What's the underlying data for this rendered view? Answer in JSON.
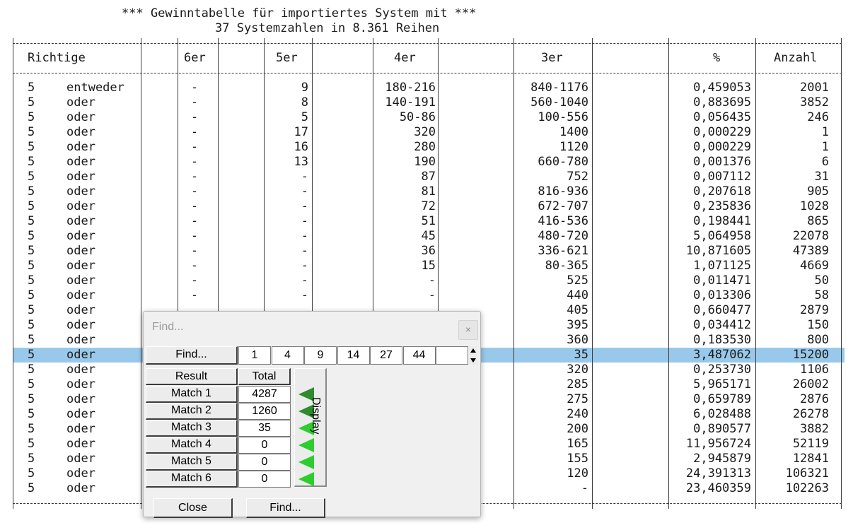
{
  "report": {
    "title_line1": "*** Gewinntabelle für importiertes System mit ***",
    "title_line2": "37 Systemzahlen in 8.361 Reihen",
    "headers": [
      "Richtige",
      "6er",
      "5er",
      "4er",
      "3er",
      "%",
      "Anzahl"
    ],
    "rows": [
      {
        "richtige": "5",
        "mode": "entweder",
        "c6": "-",
        "c5": "9",
        "c4": "180-216",
        "c3": "840-1176",
        "pct": "0,459053",
        "anzahl": "2001"
      },
      {
        "richtige": "5",
        "mode": "oder",
        "c6": "-",
        "c5": "8",
        "c4": "140-191",
        "c3": "560-1040",
        "pct": "0,883695",
        "anzahl": "3852"
      },
      {
        "richtige": "5",
        "mode": "oder",
        "c6": "-",
        "c5": "5",
        "c4": "50-86",
        "c3": "100-556",
        "pct": "0,056435",
        "anzahl": "246"
      },
      {
        "richtige": "5",
        "mode": "oder",
        "c6": "-",
        "c5": "17",
        "c4": "320",
        "c3": "1400",
        "pct": "0,000229",
        "anzahl": "1"
      },
      {
        "richtige": "5",
        "mode": "oder",
        "c6": "-",
        "c5": "16",
        "c4": "280",
        "c3": "1120",
        "pct": "0,000229",
        "anzahl": "1"
      },
      {
        "richtige": "5",
        "mode": "oder",
        "c6": "-",
        "c5": "13",
        "c4": "190",
        "c3": "660-780",
        "pct": "0,001376",
        "anzahl": "6"
      },
      {
        "richtige": "5",
        "mode": "oder",
        "c6": "-",
        "c5": "-",
        "c4": "87",
        "c3": "752",
        "pct": "0,007112",
        "anzahl": "31"
      },
      {
        "richtige": "5",
        "mode": "oder",
        "c6": "-",
        "c5": "-",
        "c4": "81",
        "c3": "816-936",
        "pct": "0,207618",
        "anzahl": "905"
      },
      {
        "richtige": "5",
        "mode": "oder",
        "c6": "-",
        "c5": "-",
        "c4": "72",
        "c3": "672-707",
        "pct": "0,235836",
        "anzahl": "1028"
      },
      {
        "richtige": "5",
        "mode": "oder",
        "c6": "-",
        "c5": "-",
        "c4": "51",
        "c3": "416-536",
        "pct": "0,198441",
        "anzahl": "865"
      },
      {
        "richtige": "5",
        "mode": "oder",
        "c6": "-",
        "c5": "-",
        "c4": "45",
        "c3": "480-720",
        "pct": "5,064958",
        "anzahl": "22078"
      },
      {
        "richtige": "5",
        "mode": "oder",
        "c6": "-",
        "c5": "-",
        "c4": "36",
        "c3": "336-621",
        "pct": "10,871605",
        "anzahl": "47389"
      },
      {
        "richtige": "5",
        "mode": "oder",
        "c6": "-",
        "c5": "-",
        "c4": "15",
        "c3": "80-365",
        "pct": "1,071125",
        "anzahl": "4669"
      },
      {
        "richtige": "5",
        "mode": "oder",
        "c6": "-",
        "c5": "-",
        "c4": "-",
        "c3": "525",
        "pct": "0,011471",
        "anzahl": "50"
      },
      {
        "richtige": "5",
        "mode": "oder",
        "c6": "-",
        "c5": "-",
        "c4": "-",
        "c3": "440",
        "pct": "0,013306",
        "anzahl": "58"
      },
      {
        "richtige": "5",
        "mode": "oder",
        "c6": "",
        "c5": "",
        "c4": "",
        "c3": "405",
        "pct": "0,660477",
        "anzahl": "2879"
      },
      {
        "richtige": "5",
        "mode": "oder",
        "c6": "",
        "c5": "",
        "c4": "",
        "c3": "395",
        "pct": "0,034412",
        "anzahl": "150"
      },
      {
        "richtige": "5",
        "mode": "oder",
        "c6": "",
        "c5": "",
        "c4": "",
        "c3": "360",
        "pct": "0,183530",
        "anzahl": "800"
      },
      {
        "richtige": "5",
        "mode": "oder",
        "c6": "",
        "c5": "",
        "c4": "",
        "c3": "35",
        "pct": "3,487062",
        "anzahl": "15200",
        "selected": true
      },
      {
        "richtige": "5",
        "mode": "oder",
        "c6": "",
        "c5": "",
        "c4": "",
        "c3": "320",
        "pct": "0,253730",
        "anzahl": "1106"
      },
      {
        "richtige": "5",
        "mode": "oder",
        "c6": "",
        "c5": "",
        "c4": "",
        "c3": "285",
        "pct": "5,965171",
        "anzahl": "26002"
      },
      {
        "richtige": "5",
        "mode": "oder",
        "c6": "",
        "c5": "",
        "c4": "",
        "c3": "275",
        "pct": "0,659789",
        "anzahl": "2876"
      },
      {
        "richtige": "5",
        "mode": "oder",
        "c6": "",
        "c5": "",
        "c4": "",
        "c3": "240",
        "pct": "6,028488",
        "anzahl": "26278"
      },
      {
        "richtige": "5",
        "mode": "oder",
        "c6": "",
        "c5": "",
        "c4": "",
        "c3": "200",
        "pct": "0,890577",
        "anzahl": "3882"
      },
      {
        "richtige": "5",
        "mode": "oder",
        "c6": "",
        "c5": "",
        "c4": "",
        "c3": "165",
        "pct": "11,956724",
        "anzahl": "52119"
      },
      {
        "richtige": "5",
        "mode": "oder",
        "c6": "",
        "c5": "",
        "c4": "",
        "c3": "155",
        "pct": "2,945879",
        "anzahl": "12841"
      },
      {
        "richtige": "5",
        "mode": "oder",
        "c6": "",
        "c5": "",
        "c4": "",
        "c3": "120",
        "pct": "24,391313",
        "anzahl": "106321"
      },
      {
        "richtige": "5",
        "mode": "oder",
        "c6": "",
        "c5": "",
        "c4": "",
        "c3": "-",
        "pct": "23,460359",
        "anzahl": "102263"
      }
    ]
  },
  "find_dialog": {
    "title": "Find...",
    "close_glyph": "×",
    "find_button": "Find...",
    "numbers": [
      "1",
      "4",
      "9",
      "14",
      "27",
      "44",
      ""
    ],
    "result_header": "Result",
    "total_header": "Total",
    "matches": [
      {
        "label": "Match 1",
        "total": "4287",
        "marker": "dark"
      },
      {
        "label": "Match 2",
        "total": "1260",
        "marker": "dark"
      },
      {
        "label": "Match 3",
        "total": "35",
        "marker": "light"
      },
      {
        "label": "Match 4",
        "total": "0",
        "marker": "light"
      },
      {
        "label": "Match 5",
        "total": "0",
        "marker": "light"
      },
      {
        "label": "Match 6",
        "total": "0",
        "marker": "light"
      }
    ],
    "display_label": "Display",
    "close_button": "Close",
    "find_bottom_button": "Find...",
    "colors": {
      "marker_dark": "#2e8b2e",
      "marker_light": "#2ecc2e",
      "selection": "#99c9ea"
    }
  }
}
